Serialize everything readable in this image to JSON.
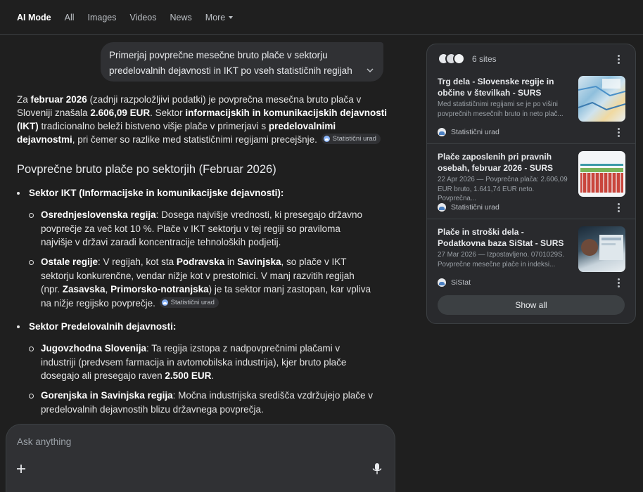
{
  "nav": {
    "tabs": [
      "AI Mode",
      "All",
      "Images",
      "Videos",
      "News",
      "More"
    ]
  },
  "query": {
    "text": "Primerjaj povprečne mesečne bruto plače v sektorju predelovalnih dejavnosti in IKT po vseh statističnih regijah za..."
  },
  "answer": {
    "intro": {
      "t1": "Za ",
      "b1": "februar 2026",
      "t2": " (zadnji razpoložljivi podatki) je povprečna mesečna bruto plača v Sloveniji znašala ",
      "b2": "2.606,09 EUR",
      "t3": ". Sektor ",
      "b3": "informacijskih in komunikacijskih dejavnosti (IKT)",
      "t4": " tradicionalno beleži bistveno višje plače v primerjavi s ",
      "b4": "predelovalnimi dejavnostmi",
      "t5": ", pri čemer so razlike med statističnimi regijami precejšnje.",
      "chip": "Statistični urad"
    },
    "heading": "Povprečne bruto plače po sektorjih (Februar 2026)",
    "sections": [
      {
        "title": "Sektor IKT (Informacijske in komunikacijske dejavnosti):",
        "items": [
          {
            "b1": "Osrednjeslovenska regija",
            "t1": ": Dosega najvišje vrednosti, ki presegajo državno povprečje za več kot 10 %. Plače v IKT sektorju v tej regiji so praviloma najvišje v državi zaradi koncentracije tehnoloških podjetij."
          },
          {
            "b1": "Ostale regije",
            "t1": ": V regijah, kot sta ",
            "b2": "Podravska",
            "t2": " in ",
            "b3": "Savinjska",
            "t3": ", so plače v IKT sektorju konkurenčne, vendar nižje kot v prestolnici. V manj razvitih regijah (npr. ",
            "b4": "Zasavska",
            "t4": ", ",
            "b5": "Primorsko-notranjska",
            "t5": ") je ta sektor manj zastopan, kar vpliva na nižje regijsko povprečje.",
            "chip": "Statistični urad"
          }
        ]
      },
      {
        "title": "Sektor Predelovalnih dejavnosti:",
        "items": [
          {
            "b1": "Jugovzhodna Slovenija",
            "t1": ": Ta regija izstopa z nadpovprečnimi plačami v industriji (predvsem farmacija in avtomobilska industrija), kjer bruto plače dosegajo ali presegajo raven ",
            "b2": "2.500 EUR",
            "t2": "."
          },
          {
            "b1": "Gorenjska in Savinjska regija",
            "t1": ": Močna industrijska središča vzdržujejo plače v predelovalnih dejavnostih blizu državnega povprečja."
          }
        ]
      }
    ]
  },
  "composer": {
    "placeholder": "Ask anything"
  },
  "sources": {
    "count_label": "6 sites",
    "cards": [
      {
        "title": "Trg dela - Slovenske regije in občine v številkah - SURS",
        "snippet": "Med statističnimi regijami se je po višini povprečnih mesečnih bruto in neto plač...",
        "source": "Statistični urad"
      },
      {
        "title": "Plače zaposlenih pri pravnih osebah, februar 2026 - SURS",
        "snippet": "22 Apr 2026 — Povprečna plača: 2.606,09 EUR bruto, 1.641,74 EUR neto. Povprečna...",
        "source": "Statistični urad"
      },
      {
        "title": "Plače in stroški dela - Podatkovna baza SiStat - SURS",
        "snippet": "27 Mar 2026 — Izpostavljeno. 0701029S. Povprečne mesečne plače in indeksi...",
        "source": "SiStat"
      }
    ],
    "show_all": "Show all"
  },
  "colors": {
    "background": "#1f1f1f",
    "surface": "#303134",
    "panel": "#292a2d",
    "text": "#e3e3e3",
    "accent": "#8ab4f8"
  },
  "icons": [
    "chevron-down-icon",
    "more-vert-icon",
    "plus-icon",
    "mic-icon",
    "statistical-office-icon",
    "sistat-icon"
  ]
}
